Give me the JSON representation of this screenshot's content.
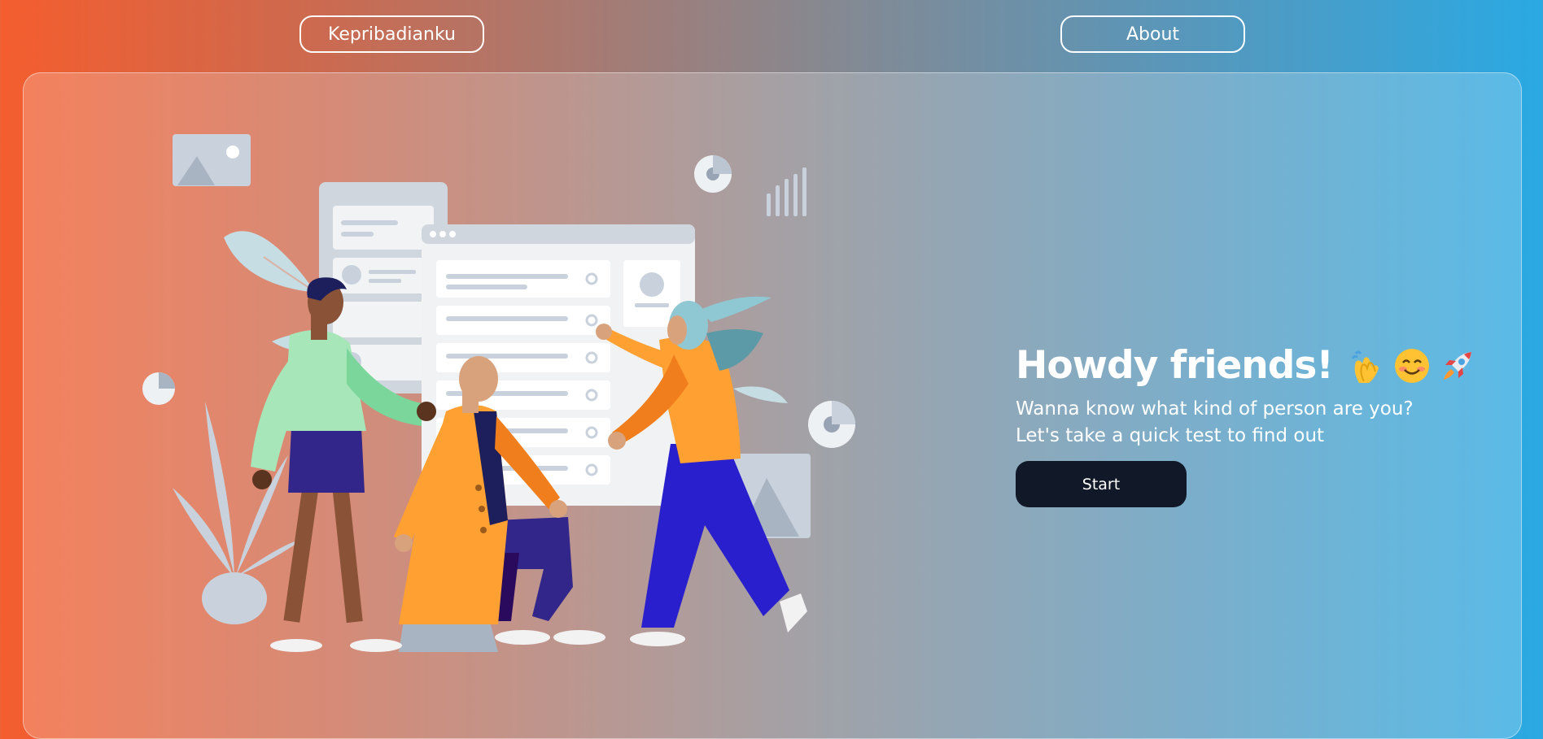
{
  "nav": {
    "brand_label": "Kepribadianku",
    "about_label": "About"
  },
  "hero": {
    "title": "Howdy friends!",
    "emojis": [
      "clapping-hands",
      "smiling-face",
      "rocket"
    ],
    "subtitle_line1": "Wanna know what kind of person are you?",
    "subtitle_line2": "Let's take a quick test to find out",
    "start_label": "Start"
  },
  "colors": {
    "gradient_left": "#f45d2e",
    "gradient_mid": "#878890",
    "gradient_right": "#2aa9e3",
    "start_button": "#111827"
  }
}
